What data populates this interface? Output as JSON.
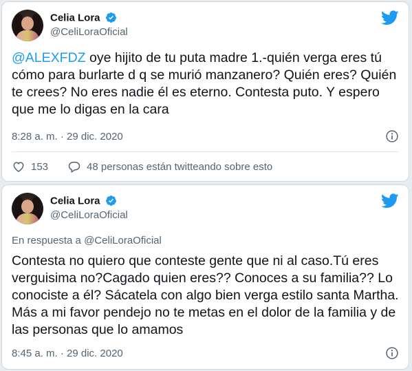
{
  "colors": {
    "background": "#e6ecf0",
    "card": "#ffffff",
    "accent": "#1d9bf0",
    "muted": "#536471"
  },
  "tweets": [
    {
      "author_name": "Celia Lora",
      "handle": "@CeliLoraOficial",
      "verified": true,
      "mention": "@ALEXFDZ",
      "text": " oye hijito de tu puta madre 1.-quién verga eres tú cómo para burlarte d q se murió manzanero? Quién eres? Quién te crees? No eres nadie él es eterno. Contesta puto. Y espero que me lo digas en la cara",
      "timestamp": "8:28 a. m. · 29 dic. 2020",
      "likes": "153",
      "conversation": "48 personas están twitteando sobre esto",
      "icons": [
        "verified-icon",
        "twitter-bird-icon",
        "info-icon",
        "heart-icon",
        "reply-bubble-icon"
      ]
    },
    {
      "author_name": "Celia Lora",
      "handle": "@CeliLoraOficial",
      "verified": true,
      "reply_label": "En respuesta a ",
      "reply_handle": "@CeliLoraOficial",
      "text": "Contesta no quiero que conteste gente que ni al caso.Tú eres verguisima no?Cagado quien eres?? Conoces a su familia?? Lo conociste a él? Sácatela con algo bien verga estilo santa Martha. Más a mi favor pendejo no te metas en el dolor de la familia y de las personas que lo amamos",
      "timestamp": "8:45 a. m. · 29 dic. 2020",
      "icons": [
        "verified-icon",
        "twitter-bird-icon",
        "info-icon"
      ]
    }
  ]
}
